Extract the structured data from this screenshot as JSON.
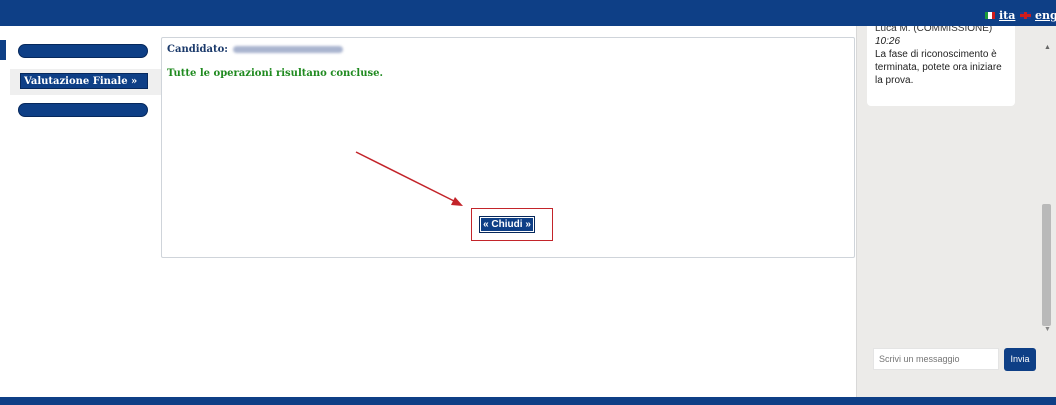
{
  "header": {
    "lang_ita": "ita",
    "lang_eng": "eng"
  },
  "sidebar": {
    "nav_button": "Valutazione Finale »"
  },
  "main": {
    "candidate_label": "Candidato:",
    "status_message": "Tutte le operazioni risultano concluse.",
    "close_button": "« Chiudi »"
  },
  "chat": {
    "message": {
      "sender_partial": "Luca M. (COMMISSIONE)",
      "time": "10:26",
      "text": "La fase di riconoscimento è terminata, potete ora iniziare la prova."
    },
    "input_placeholder": "Scrivi un messaggio",
    "send_button": "Invia"
  },
  "colors": {
    "brand_blue": "#0e3f86",
    "success_green": "#1f8a1f",
    "highlight_red": "#c3242a"
  }
}
